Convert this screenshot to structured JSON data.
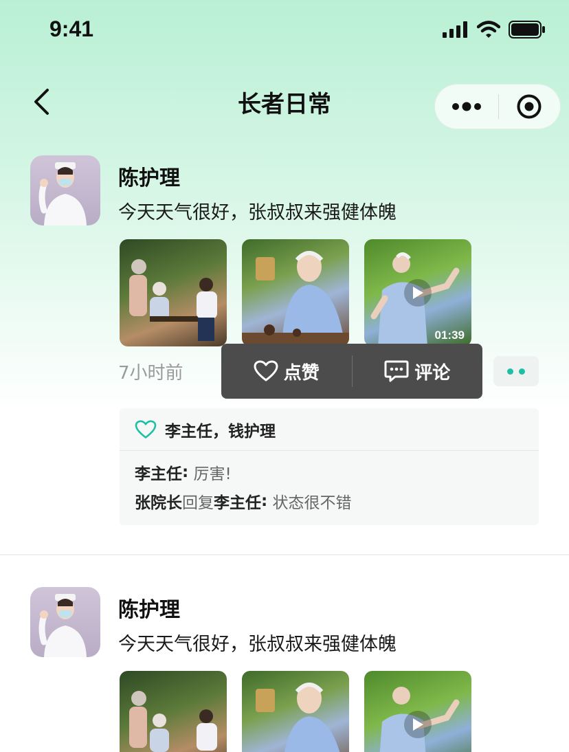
{
  "status_bar": {
    "time": "9:41"
  },
  "nav": {
    "title": "长者日常"
  },
  "posts": [
    {
      "author": "陈护理",
      "content": "今天天气很好，张叔叔来强健体魄",
      "photos": [
        "photo",
        "photo",
        "video"
      ],
      "video_duration": "01:39",
      "time_ago": "7小时前",
      "actions": {
        "like_label": "点赞",
        "comment_label": "评论"
      },
      "likes": "李主任，钱护理",
      "comments": [
        {
          "author": "李主任",
          "colon": ":",
          "text": "厉害!"
        },
        {
          "author": "张院长",
          "reply_word": "回复",
          "reply_to": "李主任",
          "colon": ":",
          "text": "状态很不错"
        }
      ]
    },
    {
      "author": "陈护理",
      "content": "今天天气很好，张叔叔来强健体魄"
    }
  ],
  "colors": {
    "accent": "#1fbfa6",
    "popup": "#4c4c4c",
    "gradient_top": "#b9f0d4"
  }
}
